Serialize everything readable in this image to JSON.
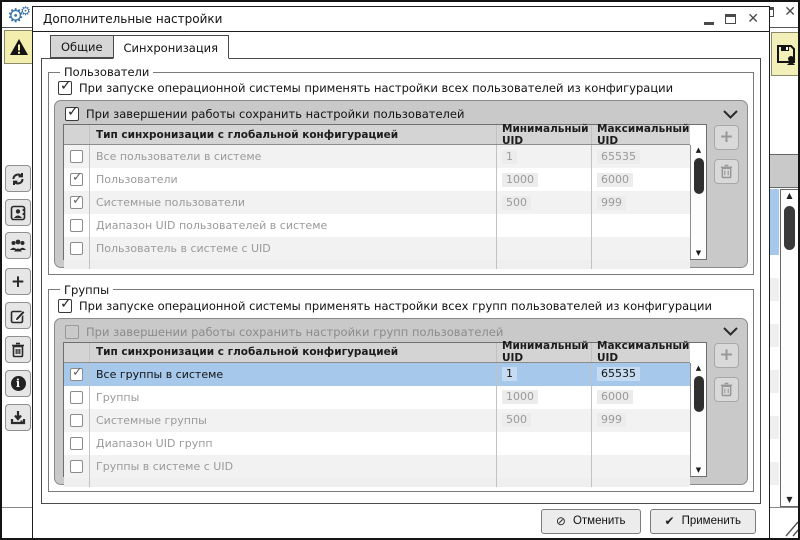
{
  "colors": {
    "selection_blue": "#a6c8ea",
    "gear_blue": "#3c74ad",
    "warning_yellow": "#f3edae",
    "panel_gray": "#c9c9c9",
    "header_gray": "#d4d4d4"
  },
  "main_window": {
    "window_buttons": [
      "maximize",
      "close"
    ],
    "toolbar_icons": [
      "settings-gears",
      "warning-triangle",
      "refresh",
      "user-card",
      "users-group",
      "add",
      "edit",
      "delete",
      "info",
      "import",
      "save-users"
    ]
  },
  "dialog": {
    "title": "Дополнительные настройки",
    "window_buttons": [
      "minimize",
      "maximize",
      "close"
    ],
    "tabs": [
      {
        "label": "Общие",
        "active": false
      },
      {
        "label": "Синхронизация",
        "active": true
      }
    ],
    "sections": [
      {
        "legend": "Пользователи",
        "startup_checkbox": {
          "label": "При запуске операционной системы применять настройки всех пользователей из конфигурации",
          "checked": true
        },
        "save_panel": {
          "label": "При завершении работы сохранить настройки пользователей",
          "checked": true,
          "disabled": false
        },
        "table": {
          "headers": [
            "Тип синхронизации с глобальной конфигурацией",
            "Минимальный UID",
            "Максимальный UID"
          ],
          "rows": [
            {
              "checked": false,
              "type": "Все пользователи в системе",
              "min": "1",
              "max": "65535",
              "selected": false
            },
            {
              "checked": true,
              "type": "Пользователи",
              "min": "1000",
              "max": "6000",
              "selected": false
            },
            {
              "checked": true,
              "type": "Системные пользователи",
              "min": "500",
              "max": "999",
              "selected": false
            },
            {
              "checked": false,
              "type": "Диапазон UID пользователей в системе",
              "min": "",
              "max": "",
              "selected": false
            },
            {
              "checked": false,
              "type": "Пользователь в системе с UID",
              "min": "",
              "max": "",
              "selected": false
            }
          ]
        }
      },
      {
        "legend": "Группы",
        "startup_checkbox": {
          "label": "При запуске операционной системы применять настройки всех групп пользователей из конфигурации",
          "checked": true
        },
        "save_panel": {
          "label": "При завершении работы сохранить настройки групп пользователей",
          "checked": false,
          "disabled": true
        },
        "table": {
          "headers": [
            "Тип синхронизации с глобальной конфигурацией",
            "Минимальный UID",
            "Максимальный UID"
          ],
          "rows": [
            {
              "checked": true,
              "type": "Все группы в системе",
              "min": "1",
              "max": "65535",
              "selected": true
            },
            {
              "checked": false,
              "type": "Группы",
              "min": "1000",
              "max": "6000",
              "selected": false
            },
            {
              "checked": false,
              "type": "Системные группы",
              "min": "500",
              "max": "999",
              "selected": false
            },
            {
              "checked": false,
              "type": "Диапазон UID групп",
              "min": "",
              "max": "",
              "selected": false
            },
            {
              "checked": false,
              "type": "Группы в системе с UID",
              "min": "",
              "max": "",
              "selected": false
            }
          ]
        }
      }
    ],
    "footer": {
      "cancel_label": "Отменить",
      "apply_label": "Применить"
    }
  }
}
